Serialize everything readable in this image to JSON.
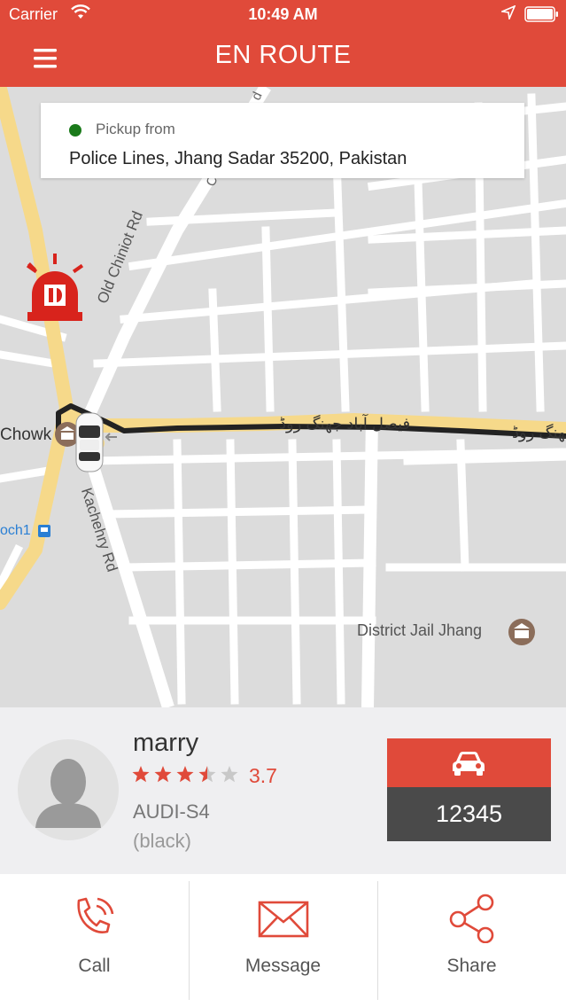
{
  "status_bar": {
    "carrier": "Carrier",
    "time": "10:49 AM"
  },
  "nav": {
    "title": "EN ROUTE",
    "menu_icon": "hamburger-menu-icon"
  },
  "map": {
    "labels": {
      "old_chiniot_rd": "Old Chiniot Rd",
      "kachehry_rd": "Kachehry Rd",
      "chowk": "Chowk",
      "och1": "och1",
      "faisalabad_rd": "فیصل آباد جھنگ روڈ",
      "jhang_rd_right": "جھنگ روڈ",
      "district_jail": "District Jail Jhang",
      "road_d": "d",
      "road_c": "C"
    },
    "icons": [
      "alarm-siren-icon",
      "museum-icon",
      "bus-stop-icon",
      "car-marker-icon"
    ]
  },
  "pickup": {
    "label": "Pickup from",
    "address": "Police Lines,  Jhang Sadar 35200,  Pakistan",
    "dot_color": "#1a7a1a"
  },
  "driver": {
    "name": "marry",
    "rating": 3.7,
    "rating_text": "3.7",
    "car_model": "AUDI-S4",
    "car_color": "(black)",
    "plate": "12345"
  },
  "actions": [
    {
      "label": "Call",
      "icon": "phone-icon"
    },
    {
      "label": "Message",
      "icon": "envelope-icon"
    },
    {
      "label": "Share",
      "icon": "share-icon"
    }
  ],
  "colors": {
    "accent": "#e04a3a",
    "route": "#222222",
    "plate_bg": "#4a4a4a"
  }
}
